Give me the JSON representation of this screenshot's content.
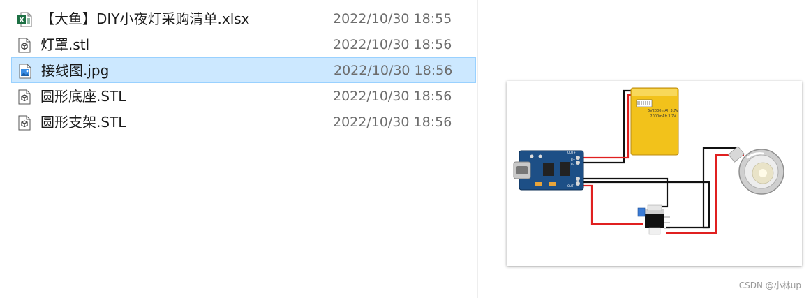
{
  "files": [
    {
      "name": "【大鱼】DIY小夜灯采购清单.xlsx",
      "date": "2022/10/30 18:55",
      "icon": "excel-icon",
      "selected": false
    },
    {
      "name": "灯罩.stl",
      "date": "2022/10/30 18:56",
      "icon": "3d-object-icon",
      "selected": false
    },
    {
      "name": "接线图.jpg",
      "date": "2022/10/30 18:56",
      "icon": "image-icon",
      "selected": true
    },
    {
      "name": "圆形底座.STL",
      "date": "2022/10/30 18:56",
      "icon": "3d-object-icon",
      "selected": false
    },
    {
      "name": "圆形支架.STL",
      "date": "2022/10/30 18:56",
      "icon": "3d-object-icon",
      "selected": false
    }
  ],
  "preview": {
    "battery_text": [
      "5V2000mAh 3.7V",
      "2000mAh 3.7V"
    ],
    "module_labels": [
      "OUT+",
      "OUT-",
      "B+",
      "B-"
    ]
  },
  "watermark": "CSDN @小林up",
  "colors": {
    "selected_bg": "#cce8ff",
    "selected_border": "#99d1ff",
    "wire_red": "#e02020",
    "wire_black": "#111111",
    "board_blue": "#1d4f86",
    "battery_yellow": "#f2c21b"
  }
}
